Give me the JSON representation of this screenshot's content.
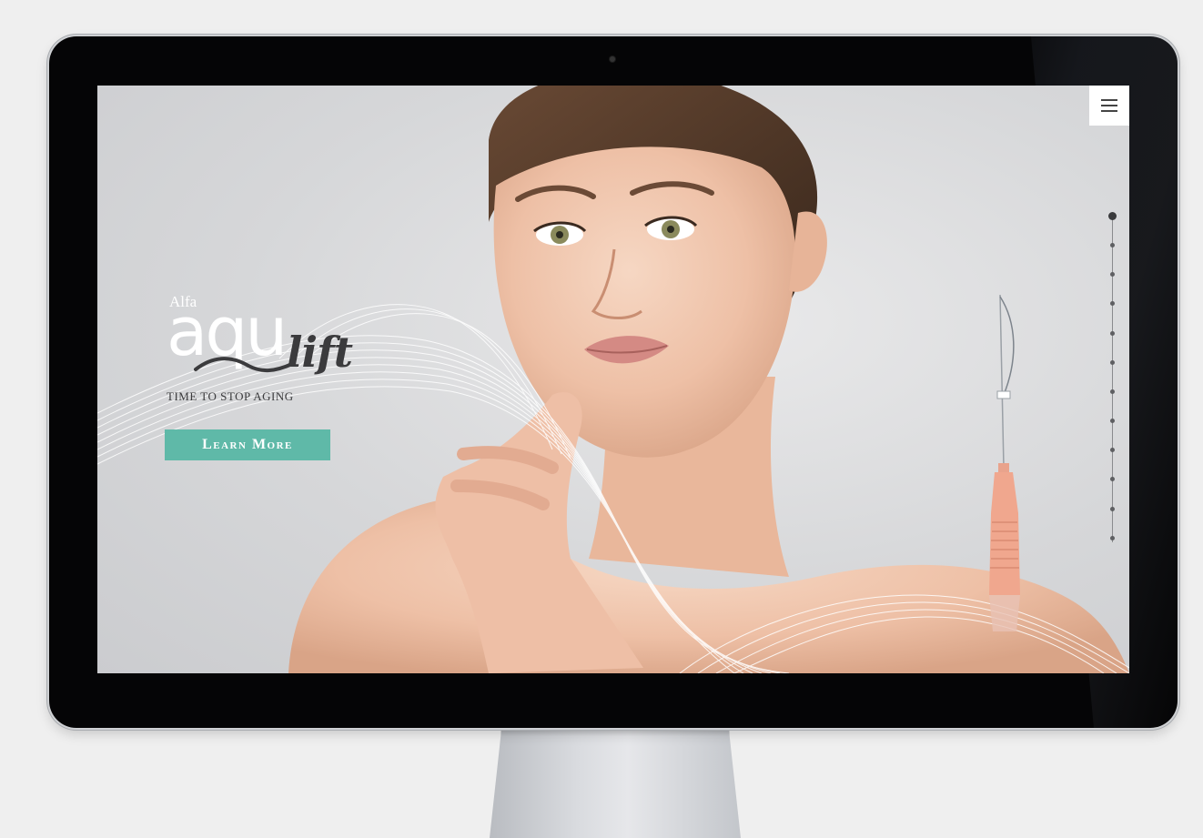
{
  "brand": {
    "small": "Alfa",
    "main": "aqu",
    "script": "lift",
    "tagline": "TIME TO STOP AGING"
  },
  "hero": {
    "cta_label": "Learn More"
  },
  "menu": {
    "icon": "hamburger-menu-icon"
  },
  "nav_dots": {
    "count": 12,
    "active_index": 0
  },
  "colors": {
    "accent": "#5fb9a8",
    "background": "#d6d7d9",
    "text_dark": "#3b3b3d"
  }
}
